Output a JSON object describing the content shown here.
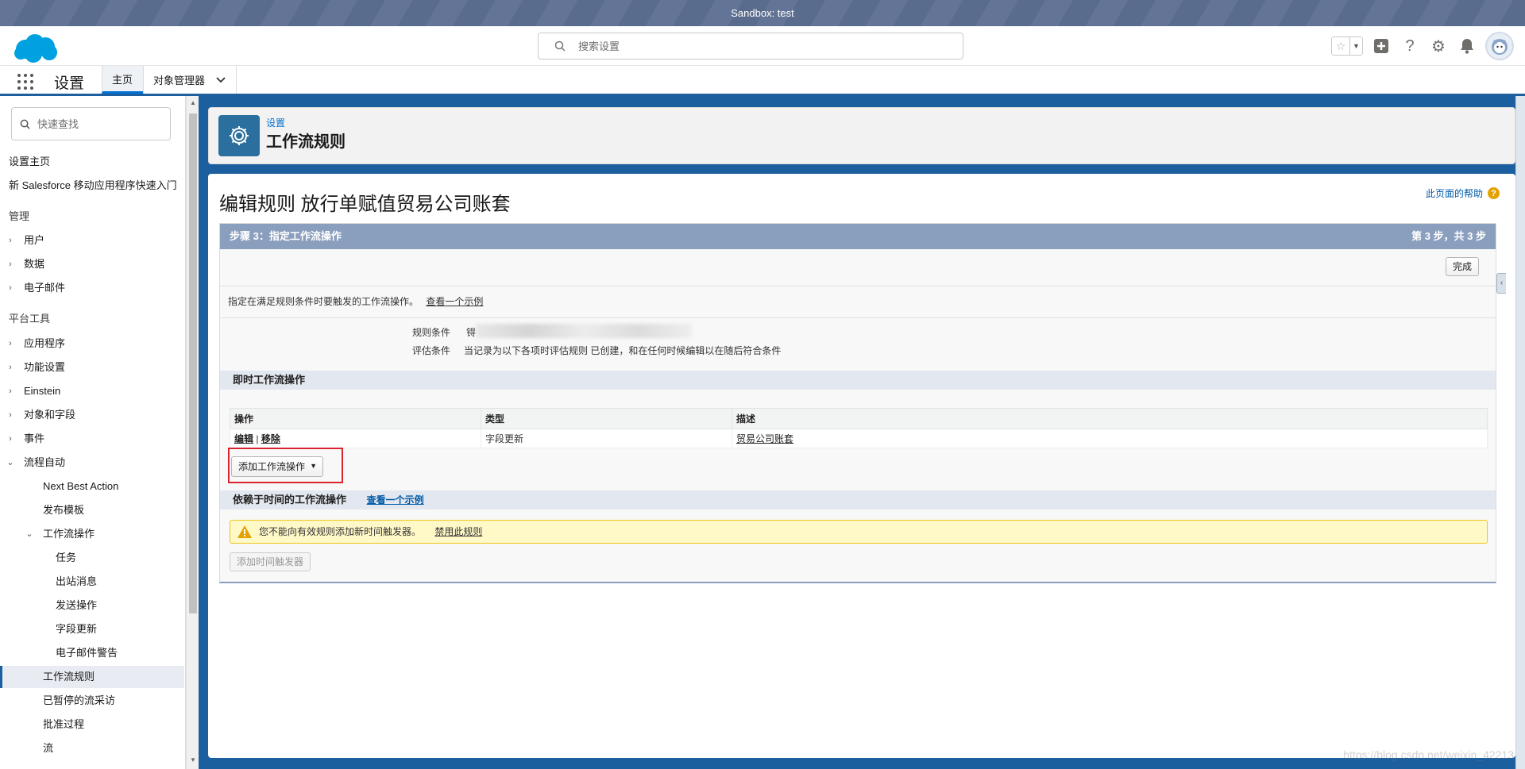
{
  "sandbox": {
    "label": "Sandbox: test"
  },
  "header": {
    "search_placeholder": "搜索设置",
    "star_icon": "☆",
    "dropdown_icon": "▼",
    "add_icon": "+",
    "help_icon": "?",
    "gear_icon": "⚙",
    "bell_icon": "🔔"
  },
  "app_nav": {
    "app_name": "设置",
    "tabs": [
      {
        "label": "主页"
      },
      {
        "label": "对象管理器"
      }
    ]
  },
  "sidebar": {
    "quickfind_placeholder": "快速查找",
    "items": [
      {
        "label": "设置主页"
      },
      {
        "label": "新 Salesforce 移动应用程序快速入门"
      },
      {
        "label": "管理"
      },
      {
        "label": "用户"
      },
      {
        "label": "数据"
      },
      {
        "label": "电子邮件"
      },
      {
        "label": "平台工具"
      },
      {
        "label": "应用程序"
      },
      {
        "label": "功能设置"
      },
      {
        "label": "Einstein"
      },
      {
        "label": "对象和字段"
      },
      {
        "label": "事件"
      },
      {
        "label": "流程自动"
      },
      {
        "label": "Next Best Action"
      },
      {
        "label": "发布模板"
      },
      {
        "label": "工作流操作"
      },
      {
        "label": "任务"
      },
      {
        "label": "出站消息"
      },
      {
        "label": "发送操作"
      },
      {
        "label": "字段更新"
      },
      {
        "label": "电子邮件警告"
      },
      {
        "label": "工作流规则"
      },
      {
        "label": "已暂停的流采访"
      },
      {
        "label": "批准过程"
      },
      {
        "label": "流"
      }
    ]
  },
  "page_header": {
    "breadcrumb": "设置",
    "title": "工作流规则"
  },
  "main": {
    "title": "编辑规则 放行单赋值贸易公司账套",
    "help_link": "此页面的帮助",
    "step_title": "步骤 3：指定工作流操作",
    "step_count": "第 3 步，共 3 步",
    "done_button": "完成",
    "description": "指定在满足规则条件时要触发的工作流操作。",
    "example_link": "查看一个示例",
    "rule_criteria_label": "规则条件",
    "rule_criteria_prefix": "锝",
    "eval_criteria_label": "评估条件",
    "eval_criteria_value": "当记录为以下各项时评估规则 已创建，和在任何时候编辑以在随后符合条件",
    "immediate_section": "即时工作流操作",
    "table": {
      "headers": [
        "操作",
        "类型",
        "描述"
      ],
      "rows": [
        {
          "edit": "编辑",
          "sep": "|",
          "remove": "移除",
          "type": "字段更新",
          "desc": "贸易公司账套"
        }
      ]
    },
    "add_action_button": "添加工作流操作",
    "time_section": "依赖于时间的工作流操作",
    "time_example_link": "查看一个示例",
    "warning_text": "您不能向有效规则添加新时间触发器。",
    "warning_link": "禁用此规则",
    "add_trigger_button": "添加时间触发器"
  },
  "watermark": "https://blog.csdn.net/weixin_42213"
}
